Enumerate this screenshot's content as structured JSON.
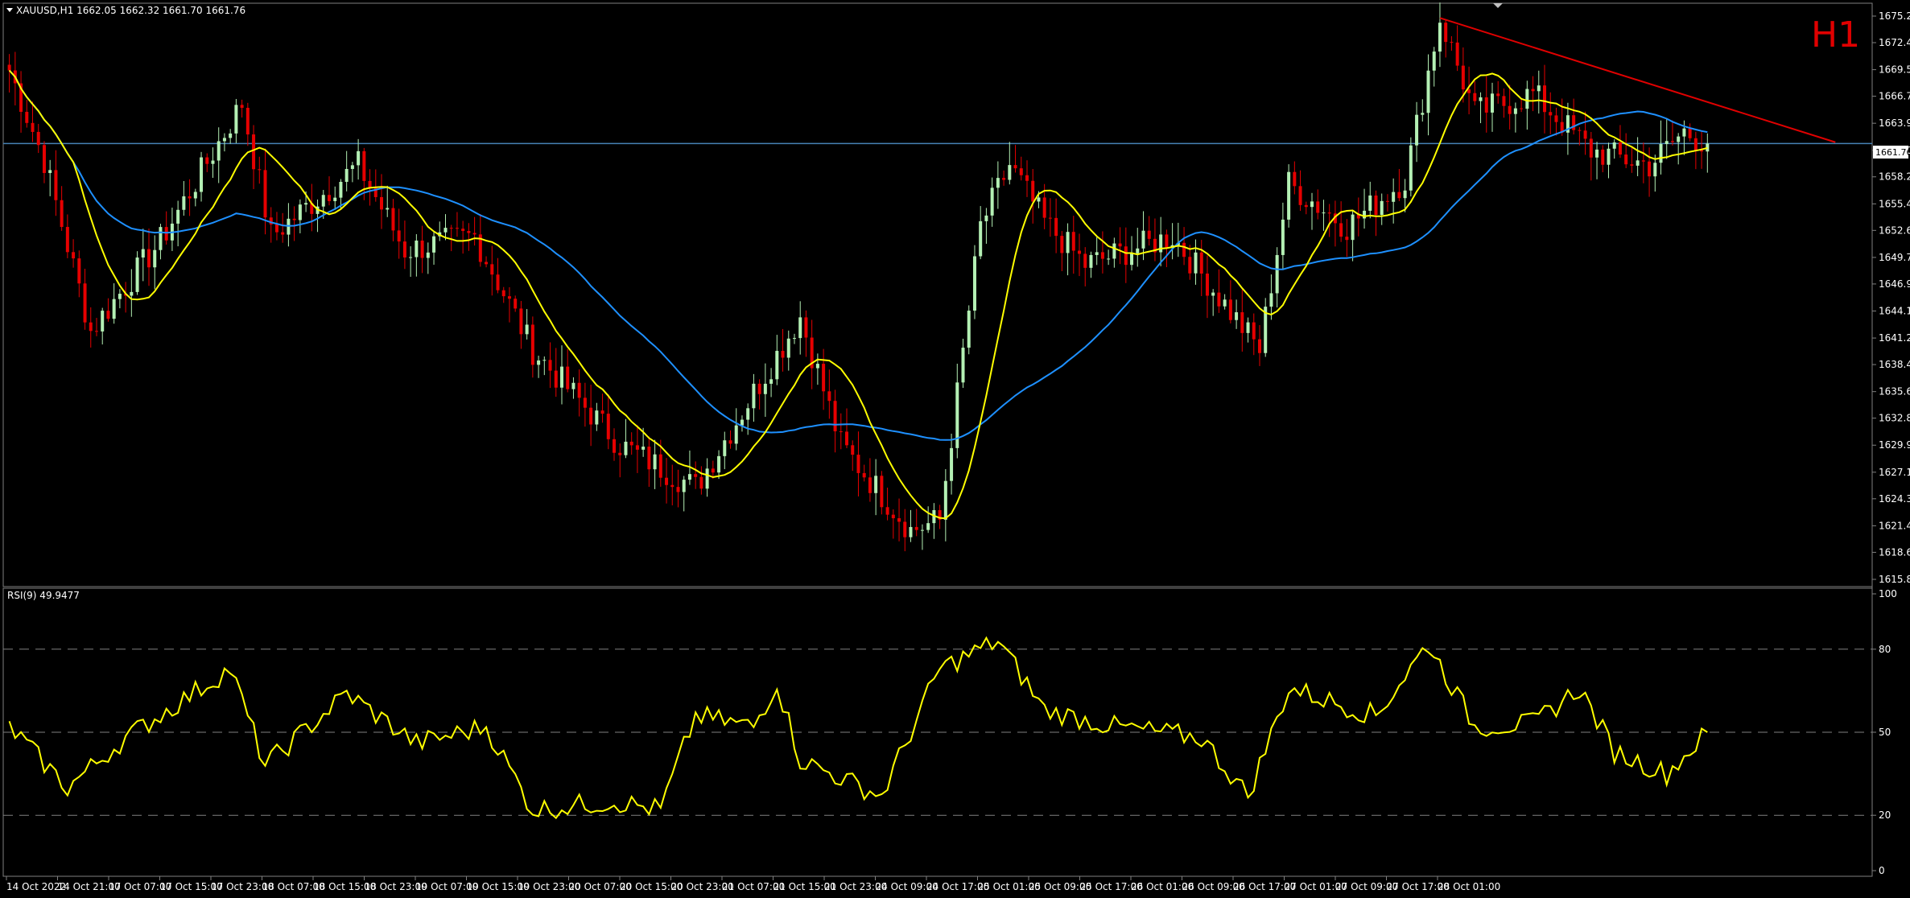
{
  "header": {
    "symbol_line": "XAUUSD,H1  1662.05 1662.32 1661.70 1661.76",
    "timeframe": "H1",
    "rsi_line": "RSI(9) 49.9477",
    "current_price": "1661.76"
  },
  "colors": {
    "background": "#000000",
    "bull": "#b4f0b4",
    "bear": "#e60000",
    "ma_fast": "#ffff00",
    "ma_slow": "#1e90ff",
    "trendline": "#e00000",
    "price_line": "#4682b4",
    "rsi": "#ffff00",
    "grid": "#808080"
  },
  "chart_data": [
    {
      "type": "candlestick",
      "series_name": "XAUUSD,H1",
      "ylim": [
        1615.8,
        1675.2
      ],
      "y_ticks": [
        "1675.20",
        "1672.40",
        "1669.55",
        "1666.75",
        "1663.90",
        "1661.05",
        "1658.25",
        "1655.40",
        "1652.60",
        "1649.75",
        "1646.95",
        "1644.10",
        "1641.25",
        "1638.45",
        "1635.60",
        "1632.80",
        "1629.95",
        "1627.10",
        "1624.30",
        "1621.45",
        "1618.65",
        "1615.80"
      ],
      "x_ticks": [
        "14 Oct 2022",
        "14 Oct 21:00",
        "17 Oct 07:00",
        "17 Oct 15:00",
        "17 Oct 23:00",
        "18 Oct 07:00",
        "18 Oct 15:00",
        "18 Oct 23:00",
        "19 Oct 07:00",
        "19 Oct 15:00",
        "19 Oct 23:00",
        "20 Oct 07:00",
        "20 Oct 15:00",
        "20 Oct 23:00",
        "21 Oct 07:00",
        "21 Oct 15:00",
        "21 Oct 23:00",
        "24 Oct 09:00",
        "24 Oct 17:00",
        "25 Oct 01:00",
        "25 Oct 09:00",
        "25 Oct 17:00",
        "26 Oct 01:00",
        "26 Oct 09:00",
        "26 Oct 17:00",
        "27 Oct 01:00",
        "27 Oct 09:00",
        "27 Oct 17:00",
        "28 Oct 01:00"
      ],
      "key_levels": [
        {
          "x": 0,
          "close": 1669.5
        },
        {
          "x": 6,
          "close": 1660.0
        },
        {
          "x": 14,
          "close": 1642.0
        },
        {
          "x": 26,
          "close": 1651.5
        },
        {
          "x": 40,
          "close": 1666.0
        },
        {
          "x": 45,
          "close": 1652.0
        },
        {
          "x": 60,
          "close": 1659.5
        },
        {
          "x": 68,
          "close": 1650.5
        },
        {
          "x": 80,
          "close": 1652.0
        },
        {
          "x": 90,
          "close": 1640.0
        },
        {
          "x": 105,
          "close": 1630.0
        },
        {
          "x": 118,
          "close": 1625.5
        },
        {
          "x": 130,
          "close": 1637.5
        },
        {
          "x": 136,
          "close": 1643.5
        },
        {
          "x": 143,
          "close": 1630.0
        },
        {
          "x": 155,
          "close": 1621.0
        },
        {
          "x": 160,
          "close": 1622.0
        },
        {
          "x": 167,
          "close": 1653.0
        },
        {
          "x": 172,
          "close": 1659.5
        },
        {
          "x": 178,
          "close": 1653.5
        },
        {
          "x": 185,
          "close": 1649.0
        },
        {
          "x": 200,
          "close": 1652.0
        },
        {
          "x": 215,
          "close": 1640.0
        },
        {
          "x": 220,
          "close": 1657.5
        },
        {
          "x": 230,
          "close": 1653.0
        },
        {
          "x": 240,
          "close": 1658.0
        },
        {
          "x": 246,
          "close": 1675.0
        },
        {
          "x": 252,
          "close": 1665.0
        },
        {
          "x": 262,
          "close": 1667.0
        },
        {
          "x": 272,
          "close": 1661.0
        },
        {
          "x": 282,
          "close": 1659.5
        },
        {
          "x": 288,
          "close": 1663.0
        },
        {
          "x": 292,
          "close": 1661.76
        }
      ],
      "trendline": {
        "from": {
          "x": 246,
          "price": 1675.0
        },
        "to": {
          "x": 314,
          "price": 1661.9
        }
      }
    },
    {
      "type": "line",
      "series_name": "RSI(9)",
      "ylim": [
        0,
        100
      ],
      "y_ticks": [
        "100",
        "80",
        "50",
        "20",
        "0"
      ],
      "levels": [
        80,
        50,
        20
      ],
      "key_points": [
        {
          "x": 0,
          "y": 52
        },
        {
          "x": 10,
          "y": 30
        },
        {
          "x": 20,
          "y": 48
        },
        {
          "x": 38,
          "y": 73
        },
        {
          "x": 44,
          "y": 38
        },
        {
          "x": 58,
          "y": 64
        },
        {
          "x": 70,
          "y": 46
        },
        {
          "x": 82,
          "y": 52
        },
        {
          "x": 90,
          "y": 22
        },
        {
          "x": 104,
          "y": 25
        },
        {
          "x": 112,
          "y": 22
        },
        {
          "x": 118,
          "y": 56
        },
        {
          "x": 128,
          "y": 52
        },
        {
          "x": 132,
          "y": 68
        },
        {
          "x": 136,
          "y": 40
        },
        {
          "x": 150,
          "y": 27
        },
        {
          "x": 160,
          "y": 73
        },
        {
          "x": 170,
          "y": 83
        },
        {
          "x": 178,
          "y": 58
        },
        {
          "x": 190,
          "y": 52
        },
        {
          "x": 205,
          "y": 48
        },
        {
          "x": 213,
          "y": 27
        },
        {
          "x": 220,
          "y": 66
        },
        {
          "x": 235,
          "y": 56
        },
        {
          "x": 244,
          "y": 82
        },
        {
          "x": 252,
          "y": 52
        },
        {
          "x": 262,
          "y": 53
        },
        {
          "x": 270,
          "y": 66
        },
        {
          "x": 276,
          "y": 43
        },
        {
          "x": 285,
          "y": 35
        },
        {
          "x": 292,
          "y": 50
        }
      ]
    }
  ]
}
